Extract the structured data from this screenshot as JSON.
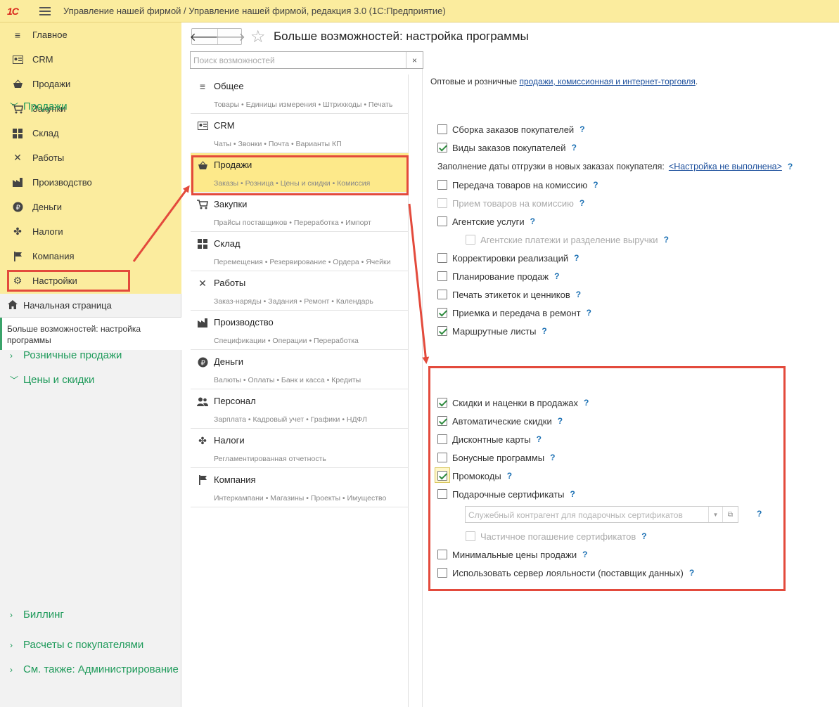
{
  "app": {
    "logo": "1С",
    "title": "Управление нашей фирмой / Управление нашей фирмой, редакция 3.0  (1С:Предприятие)"
  },
  "sections": [
    {
      "label": "Главное",
      "icon": "menu-lines-icon"
    },
    {
      "label": "CRM",
      "icon": "contact-card-icon"
    },
    {
      "label": "Продажи",
      "icon": "basket-icon"
    },
    {
      "label": "Закупки",
      "icon": "cart-icon"
    },
    {
      "label": "Склад",
      "icon": "warehouse-grid-icon"
    },
    {
      "label": "Работы",
      "icon": "tools-icon"
    },
    {
      "label": "Производство",
      "icon": "factory-icon"
    },
    {
      "label": "Деньги",
      "icon": "ruble-coin-icon"
    },
    {
      "label": "Налоги",
      "icon": "emblem-icon"
    },
    {
      "label": "Компания",
      "icon": "flag-icon"
    },
    {
      "label": "Настройки",
      "icon": "gear-icon"
    }
  ],
  "nav": {
    "home": "Начальная страница",
    "open_window": "Больше возможностей: настройка программы"
  },
  "page": {
    "title": "Больше возможностей: настройка программы",
    "search_placeholder": "Поиск возможностей",
    "clear": "×"
  },
  "categories": [
    {
      "title": "Общее",
      "sub": "Товары • Единицы измерения • Штрихкоды • Печать"
    },
    {
      "title": "CRM",
      "sub": "Чаты • Звонки • Почта • Варианты КП"
    },
    {
      "title": "Продажи",
      "sub": "Заказы • Розница • Цены и скидки • Комиссия"
    },
    {
      "title": "Закупки",
      "sub": "Прайсы поставщиков • Переработка • Импорт"
    },
    {
      "title": "Склад",
      "sub": "Перемещения • Резервирование • Ордера • Ячейки"
    },
    {
      "title": "Работы",
      "sub": "Заказ-наряды • Задания • Ремонт • Календарь"
    },
    {
      "title": "Производство",
      "sub": "Спецификации • Операции • Переработка"
    },
    {
      "title": "Деньги",
      "sub": "Валюты • Оплаты • Банк и касса • Кредиты"
    },
    {
      "title": "Персонал",
      "sub": "Зарплата • Кадровый учет • Графики • НДФЛ"
    },
    {
      "title": "Налоги",
      "sub": "Регламентированная отчетность"
    },
    {
      "title": "Компания",
      "sub": "Интеркампани • Магазины • Проекты • Имущество"
    }
  ],
  "settings": {
    "intro_prefix": "Оптовые и розничные ",
    "intro_link": "продажи, комиссионная и интернет-торговля",
    "intro_suffix": ".",
    "help": "?",
    "groups": {
      "sales": "Продажи",
      "retail": "Розничные продажи",
      "prices": "Цены и скидки",
      "billing": "Биллинг",
      "settlements": "Расчеты с покупателями",
      "see_also": "См. также: Администрирование"
    },
    "sales_items": [
      {
        "label": "Сборка заказов покупателей",
        "checked": false,
        "disabled": false
      },
      {
        "label": "Виды заказов покупателей",
        "checked": true,
        "disabled": false
      }
    ],
    "shipping_date_label": "Заполнение даты отгрузки в новых заказах покупателя:",
    "shipping_date_link": "<Настройка не выполнена>",
    "sales_items2": [
      {
        "label": "Передача товаров на комиссию",
        "checked": false,
        "disabled": false
      },
      {
        "label": "Прием товаров на комиссию",
        "checked": false,
        "disabled": true
      },
      {
        "label": "Агентские услуги",
        "checked": false,
        "disabled": false
      },
      {
        "label": "Агентские платежи и разделение выручки",
        "checked": false,
        "disabled": true
      },
      {
        "label": "Корректировки реализаций",
        "checked": false,
        "disabled": false
      },
      {
        "label": "Планирование продаж",
        "checked": false,
        "disabled": false
      },
      {
        "label": "Печать этикеток и ценников",
        "checked": false,
        "disabled": false
      },
      {
        "label": "Приемка и передача в ремонт",
        "checked": true,
        "disabled": false
      },
      {
        "label": "Маршрутные листы",
        "checked": true,
        "disabled": false
      }
    ],
    "price_items": [
      {
        "label": "Скидки и наценки в продажах",
        "checked": true,
        "disabled": false
      },
      {
        "label": "Автоматические скидки",
        "checked": true,
        "disabled": false
      },
      {
        "label": "Дисконтные карты",
        "checked": false,
        "disabled": false
      },
      {
        "label": "Бонусные программы",
        "checked": false,
        "disabled": false
      },
      {
        "label": "Промокоды",
        "checked": true,
        "disabled": false
      },
      {
        "label": "Подарочные сертификаты",
        "checked": false,
        "disabled": false
      }
    ],
    "gift_counterparty_placeholder": "Служебный контрагент для подарочных сертификатов",
    "partial_redemption": {
      "label": "Частичное погашение сертификатов",
      "checked": false,
      "disabled": true
    },
    "price_items2": [
      {
        "label": "Минимальные цены продажи",
        "checked": false,
        "disabled": false
      },
      {
        "label": "Использовать сервер лояльности (поставщик данных)",
        "checked": false,
        "disabled": false
      }
    ]
  },
  "colors": {
    "section_bg": "#fbec9e",
    "active_category": "#fde98a",
    "group_heading": "#1e9a5a",
    "highlight": "#e34a3c",
    "link": "#1c4f9c"
  }
}
